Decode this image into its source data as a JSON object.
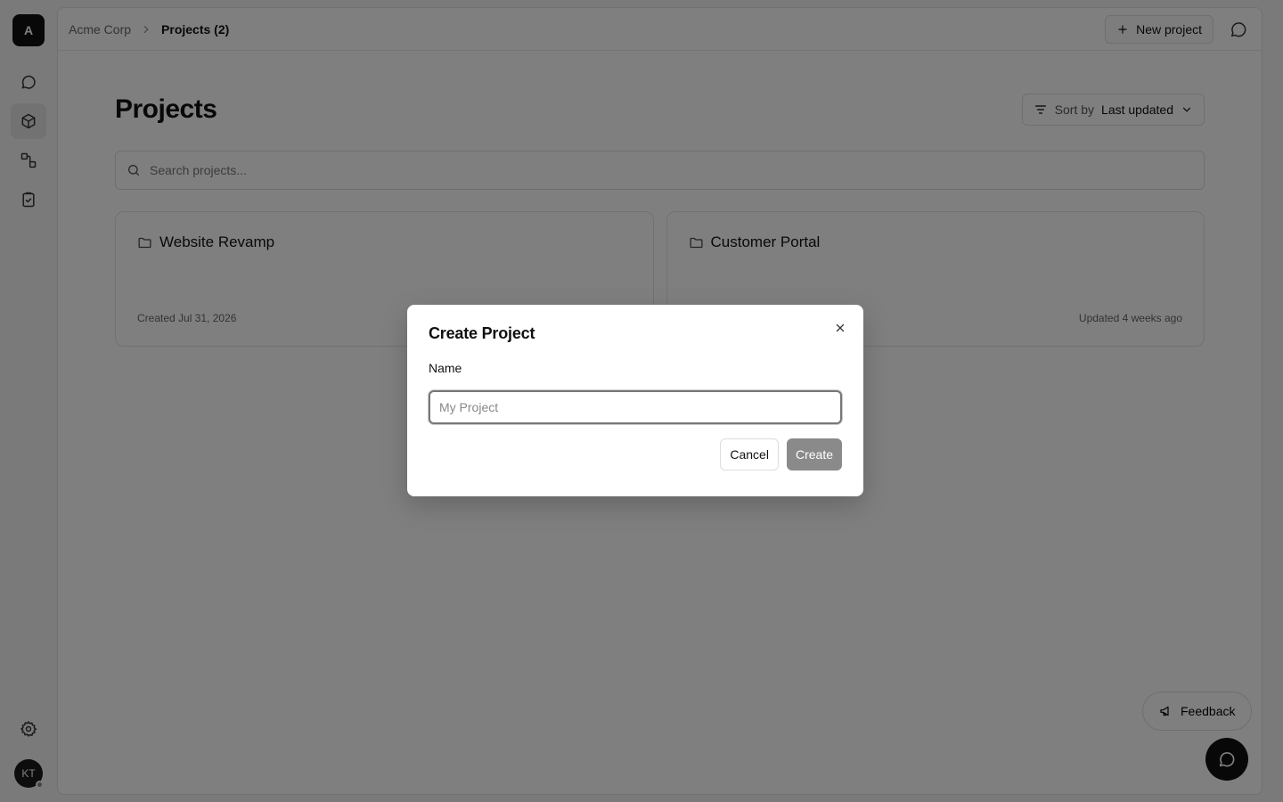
{
  "sidebar": {
    "logo_letter": "A",
    "nav_items": [
      {
        "name": "chat",
        "icon": "chat-bubble-icon",
        "active": false
      },
      {
        "name": "projects",
        "icon": "cube-icon",
        "active": true
      },
      {
        "name": "workflows",
        "icon": "flow-icon",
        "active": false
      },
      {
        "name": "tasks",
        "icon": "clipboard-check-icon",
        "active": false
      }
    ],
    "settings_icon": "gear-icon",
    "avatar_initials": "KT"
  },
  "topbar": {
    "breadcrumb_org": "Acme Corp",
    "breadcrumb_current": "Projects (2)",
    "new_project_label": "New project"
  },
  "page": {
    "title": "Projects",
    "sort_label": "Sort by",
    "sort_value": "Last updated",
    "search_placeholder": "Search projects..."
  },
  "projects": [
    {
      "name": "Website Revamp",
      "meta": "Created Jul 31, 2026"
    },
    {
      "name": "Customer Portal",
      "meta": "Updated 4 weeks ago"
    }
  ],
  "floating": {
    "feedback_label": "Feedback"
  },
  "modal": {
    "title": "Create Project",
    "field_label": "Name",
    "input_placeholder": "My Project",
    "input_value": "",
    "cancel_label": "Cancel",
    "create_label": "Create"
  },
  "colors": {
    "overlay": "#000000",
    "primary_dark": "#111111",
    "create_disabled": "#8a8a8a"
  }
}
